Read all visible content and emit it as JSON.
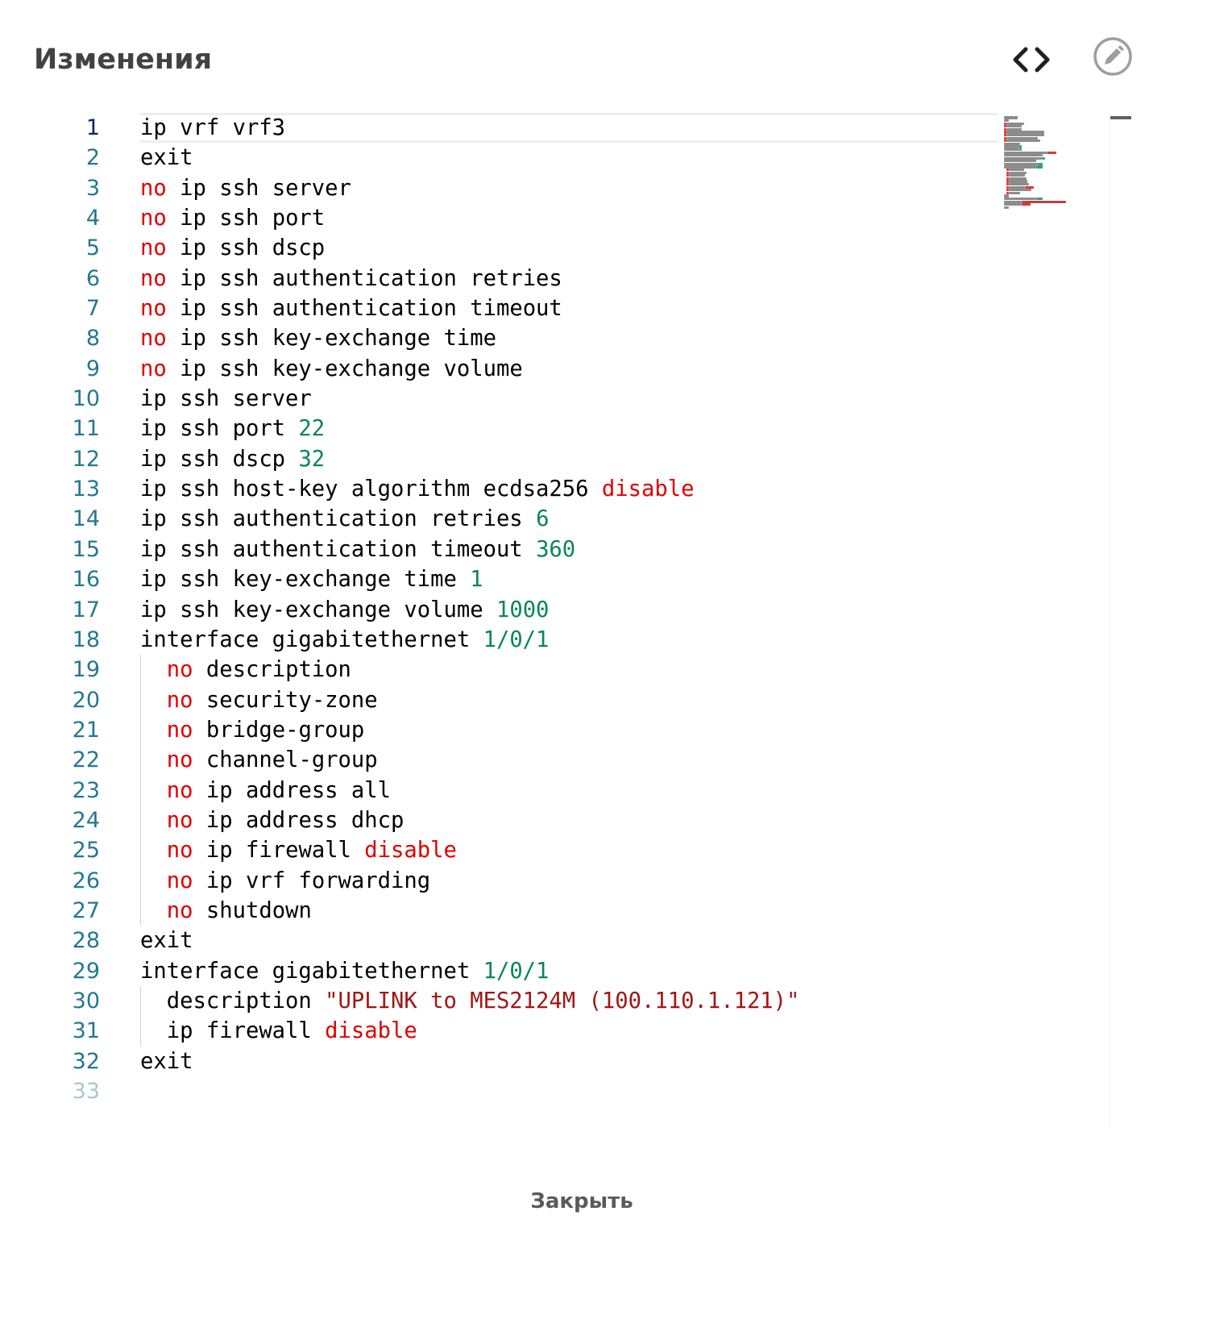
{
  "dialog": {
    "title": "Изменения",
    "close_label": "Закрыть"
  },
  "icons": {
    "code_toggle": "code-brackets-icon",
    "edit": "pencil-circle-icon"
  },
  "colors": {
    "keyword": "#e00000",
    "number": "#098658",
    "string": "#a31515",
    "line_number": "#237893",
    "line_number_active": "#0b216f"
  },
  "editor": {
    "active_line": 1,
    "line_numbers": [
      "1",
      "2",
      "3",
      "4",
      "5",
      "6",
      "7",
      "8",
      "9",
      "10",
      "11",
      "12",
      "13",
      "14",
      "15",
      "16",
      "17",
      "18",
      "19",
      "20",
      "21",
      "22",
      "23",
      "24",
      "25",
      "26",
      "27",
      "28",
      "29",
      "30",
      "31",
      "32",
      "33"
    ],
    "lines": [
      [
        {
          "t": "ip vrf vrf3",
          "c": ""
        }
      ],
      [
        {
          "t": "exit",
          "c": ""
        }
      ],
      [
        {
          "t": "no",
          "c": "kw"
        },
        {
          "t": " ip ssh server",
          "c": ""
        }
      ],
      [
        {
          "t": "no",
          "c": "kw"
        },
        {
          "t": " ip ssh port",
          "c": ""
        }
      ],
      [
        {
          "t": "no",
          "c": "kw"
        },
        {
          "t": " ip ssh dscp",
          "c": ""
        }
      ],
      [
        {
          "t": "no",
          "c": "kw"
        },
        {
          "t": " ip ssh authentication retries",
          "c": ""
        }
      ],
      [
        {
          "t": "no",
          "c": "kw"
        },
        {
          "t": " ip ssh authentication timeout",
          "c": ""
        }
      ],
      [
        {
          "t": "no",
          "c": "kw"
        },
        {
          "t": " ip ssh key-exchange time",
          "c": ""
        }
      ],
      [
        {
          "t": "no",
          "c": "kw"
        },
        {
          "t": " ip ssh key-exchange volume",
          "c": ""
        }
      ],
      [
        {
          "t": "ip ssh server",
          "c": ""
        }
      ],
      [
        {
          "t": "ip ssh port ",
          "c": ""
        },
        {
          "t": "22",
          "c": "num"
        }
      ],
      [
        {
          "t": "ip ssh dscp ",
          "c": ""
        },
        {
          "t": "32",
          "c": "num"
        }
      ],
      [
        {
          "t": "ip ssh host-key algorithm ecdsa256 ",
          "c": ""
        },
        {
          "t": "disable",
          "c": "kw"
        }
      ],
      [
        {
          "t": "ip ssh authentication retries ",
          "c": ""
        },
        {
          "t": "6",
          "c": "num"
        }
      ],
      [
        {
          "t": "ip ssh authentication timeout ",
          "c": ""
        },
        {
          "t": "360",
          "c": "num"
        }
      ],
      [
        {
          "t": "ip ssh key-exchange time ",
          "c": ""
        },
        {
          "t": "1",
          "c": "num"
        }
      ],
      [
        {
          "t": "ip ssh key-exchange volume ",
          "c": ""
        },
        {
          "t": "1000",
          "c": "num"
        }
      ],
      [
        {
          "t": "interface gigabitethernet ",
          "c": ""
        },
        {
          "t": "1/0/1",
          "c": "num"
        }
      ],
      [
        {
          "t": "  ",
          "c": ""
        },
        {
          "t": "no",
          "c": "kw"
        },
        {
          "t": " description",
          "c": ""
        }
      ],
      [
        {
          "t": "  ",
          "c": ""
        },
        {
          "t": "no",
          "c": "kw"
        },
        {
          "t": " security-zone",
          "c": ""
        }
      ],
      [
        {
          "t": "  ",
          "c": ""
        },
        {
          "t": "no",
          "c": "kw"
        },
        {
          "t": " bridge-group",
          "c": ""
        }
      ],
      [
        {
          "t": "  ",
          "c": ""
        },
        {
          "t": "no",
          "c": "kw"
        },
        {
          "t": " channel-group",
          "c": ""
        }
      ],
      [
        {
          "t": "  ",
          "c": ""
        },
        {
          "t": "no",
          "c": "kw"
        },
        {
          "t": " ip address all",
          "c": ""
        }
      ],
      [
        {
          "t": "  ",
          "c": ""
        },
        {
          "t": "no",
          "c": "kw"
        },
        {
          "t": " ip address dhcp",
          "c": ""
        }
      ],
      [
        {
          "t": "  ",
          "c": ""
        },
        {
          "t": "no",
          "c": "kw"
        },
        {
          "t": " ip firewall ",
          "c": ""
        },
        {
          "t": "disable",
          "c": "kw"
        }
      ],
      [
        {
          "t": "  ",
          "c": ""
        },
        {
          "t": "no",
          "c": "kw"
        },
        {
          "t": " ip vrf forwarding",
          "c": ""
        }
      ],
      [
        {
          "t": "  ",
          "c": ""
        },
        {
          "t": "no",
          "c": "kw"
        },
        {
          "t": " shutdown",
          "c": ""
        }
      ],
      [
        {
          "t": "exit",
          "c": ""
        }
      ],
      [
        {
          "t": "interface gigabitethernet ",
          "c": ""
        },
        {
          "t": "1/0/1",
          "c": "num"
        }
      ],
      [
        {
          "t": "  description ",
          "c": ""
        },
        {
          "t": "\"UPLINK to MES2124M (100.110.1.121)\"",
          "c": "str"
        }
      ],
      [
        {
          "t": "  ip firewall ",
          "c": ""
        },
        {
          "t": "disable",
          "c": "kw"
        }
      ],
      [
        {
          "t": "exit",
          "c": ""
        }
      ],
      []
    ]
  }
}
